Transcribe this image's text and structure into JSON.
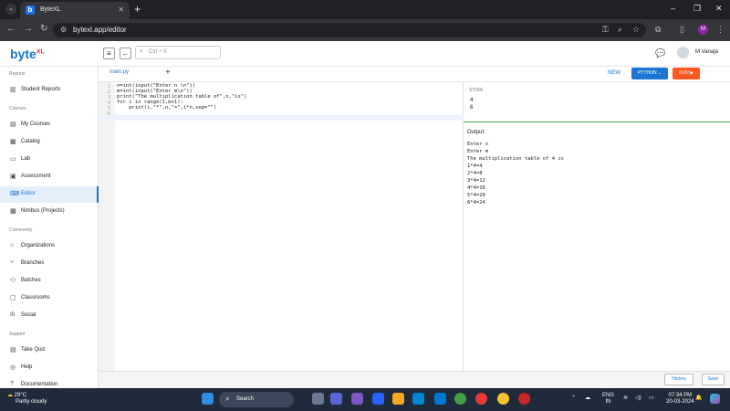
{
  "browser": {
    "tab_title": "ByteXL",
    "url": "bytexl.app/editor"
  },
  "header": {
    "brand": "byte",
    "brand_sup": "XL",
    "search_placeholder": "Ctrl + K",
    "user_name": "M Vanaja"
  },
  "sidebar": {
    "sections": [
      {
        "label": "Reports",
        "items": [
          {
            "label": "Student Reports",
            "icon": "bar-chart-icon"
          }
        ]
      },
      {
        "label": "Courses",
        "items": [
          {
            "label": "My Courses",
            "icon": "book-icon"
          },
          {
            "label": "Catalog",
            "icon": "catalog-icon"
          },
          {
            "label": "Lab",
            "icon": "lab-icon"
          },
          {
            "label": "Assessment",
            "icon": "assessment-icon"
          },
          {
            "label": "Editor",
            "icon": "code-icon",
            "active": true
          },
          {
            "label": "Nimbus (Projects)",
            "icon": "project-icon"
          }
        ]
      },
      {
        "label": "Community",
        "items": [
          {
            "label": "Organizations",
            "icon": "building-icon"
          },
          {
            "label": "Branches",
            "icon": "branch-icon"
          },
          {
            "label": "Batches",
            "icon": "group-icon"
          },
          {
            "label": "Classrooms",
            "icon": "classroom-icon"
          },
          {
            "label": "Social",
            "icon": "social-icon"
          }
        ]
      },
      {
        "label": "Support",
        "items": [
          {
            "label": "Take Quiz",
            "icon": "quiz-icon"
          },
          {
            "label": "Help",
            "icon": "help-icon"
          },
          {
            "label": "Documentation",
            "icon": "doc-icon"
          }
        ]
      }
    ]
  },
  "editor": {
    "file_tab": "main.py",
    "new_label": "NEW",
    "language_label": "PYTHON",
    "run_label": "RUN",
    "code_lines": [
      "n=int(input(\"Enter n \\n\"))",
      "m=int(input(\"Enter m\\n\"))",
      "print(\"The multiplication table of\",n,\"is\")",
      "for i in range(1,m+1):",
      "    print(i,\"*\",n,\"=\",i*n,sep=\"\")",
      ""
    ],
    "line_numbers": [
      "1",
      "2",
      "3",
      "4",
      "5",
      "6"
    ]
  },
  "stdin": {
    "label": "STDIN",
    "values": [
      "4",
      "6"
    ]
  },
  "output": {
    "label": "Output:",
    "lines": [
      "Enter n",
      "Enter m",
      "The multiplication table of 4 is",
      "1*4=4",
      "2*4=8",
      "3*4=12",
      "4*4=16",
      "5*4=20",
      "6*4=24"
    ]
  },
  "footer": {
    "history_label": "History",
    "save_label": "Save"
  },
  "taskbar": {
    "weather_temp": "29°C",
    "weather_desc": "Partly cloudy",
    "search_label": "Search",
    "lang_top": "ENG",
    "lang_bottom": "IN",
    "time": "07:34 PM",
    "date": "20-03-2024"
  }
}
